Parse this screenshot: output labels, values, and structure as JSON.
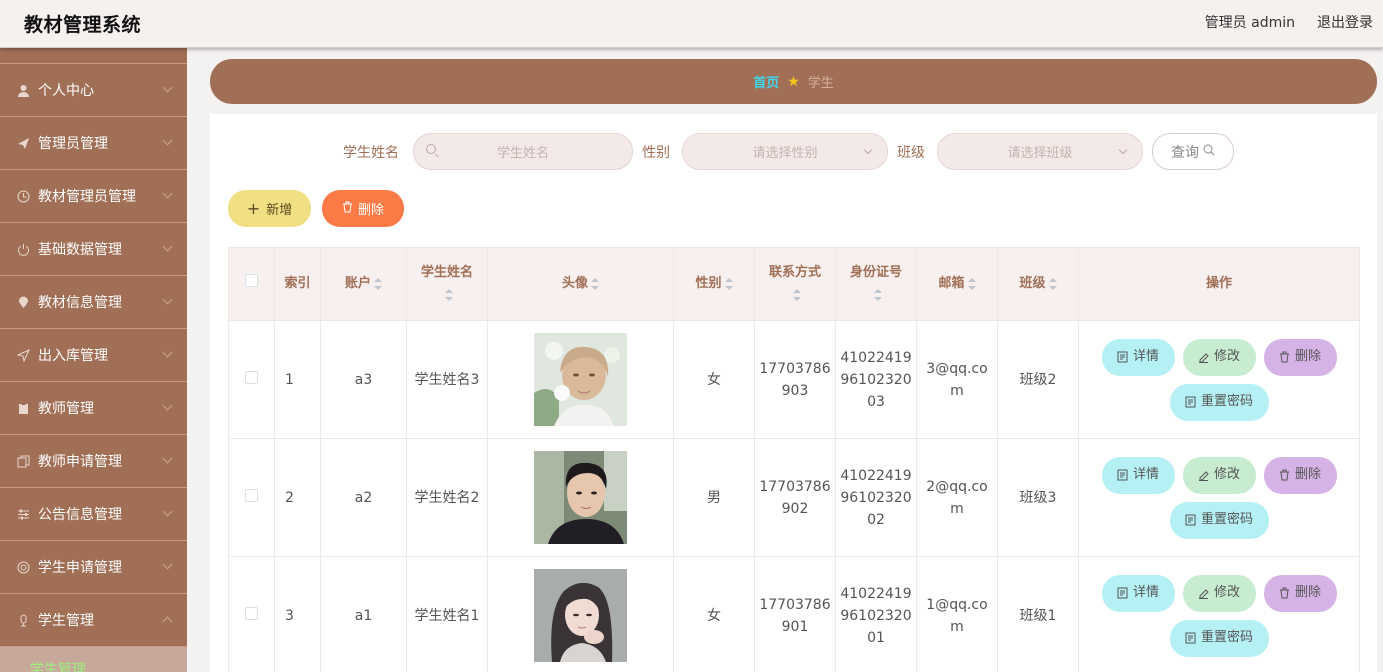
{
  "header": {
    "app_title": "教材管理系统",
    "user_label": "管理员 admin",
    "logout_label": "退出登录"
  },
  "sidebar": {
    "items": [
      {
        "label": "个人中心",
        "icon": "user-icon"
      },
      {
        "label": "管理员管理",
        "icon": "send-icon"
      },
      {
        "label": "教材管理员管理",
        "icon": "clock-icon"
      },
      {
        "label": "基础数据管理",
        "icon": "power-icon"
      },
      {
        "label": "教材信息管理",
        "icon": "location-icon"
      },
      {
        "label": "出入库管理",
        "icon": "navigate-icon"
      },
      {
        "label": "教师管理",
        "icon": "clipboard-icon"
      },
      {
        "label": "教师申请管理",
        "icon": "copy-icon"
      },
      {
        "label": "公告信息管理",
        "icon": "sliders-icon"
      },
      {
        "label": "学生申请管理",
        "icon": "target-icon"
      },
      {
        "label": "学生管理",
        "icon": "mic-icon"
      }
    ],
    "sub_item": "学生管理"
  },
  "breadcrumb": {
    "home": "首页",
    "current": "学生"
  },
  "search": {
    "name_label": "学生姓名",
    "name_placeholder": "学生姓名",
    "gender_label": "性别",
    "gender_placeholder": "请选择性别",
    "class_label": "班级",
    "class_placeholder": "请选择班级",
    "query_label": "查询"
  },
  "actions": {
    "add_label": "新增",
    "delete_label": "删除"
  },
  "table": {
    "headers": {
      "index": "索引",
      "account": "账户",
      "name": "学生姓名",
      "avatar": "头像",
      "gender": "性别",
      "phone": "联系方式",
      "id_card": "身份证号",
      "email": "邮箱",
      "class": "班级",
      "operations": "操作"
    },
    "row_actions": {
      "detail": "详情",
      "edit": "修改",
      "remove": "删除",
      "reset": "重置密码"
    },
    "rows": [
      {
        "index": "1",
        "account": "a3",
        "name": "学生姓名3",
        "gender": "女",
        "phone_a": "17703786",
        "phone_b": "903",
        "id_a": "41022419",
        "id_b": "96102320",
        "id_c": "03",
        "email_a": "3@qq.co",
        "email_b": "m",
        "class": "班级2"
      },
      {
        "index": "2",
        "account": "a2",
        "name": "学生姓名2",
        "gender": "男",
        "phone_a": "17703786",
        "phone_b": "902",
        "id_a": "41022419",
        "id_b": "96102320",
        "id_c": "02",
        "email_a": "2@qq.co",
        "email_b": "m",
        "class": "班级3"
      },
      {
        "index": "3",
        "account": "a1",
        "name": "学生姓名1",
        "gender": "女",
        "phone_a": "17703786",
        "phone_b": "901",
        "id_a": "41022419",
        "id_b": "96102320",
        "id_c": "01",
        "email_a": "1@qq.co",
        "email_b": "m",
        "class": "班级1"
      }
    ]
  },
  "colors": {
    "accent_brown": "#a16f56",
    "breadcrumb_home": "#3dd6ef",
    "add_button": "#f0df83",
    "delete_button": "#fb7a45"
  }
}
